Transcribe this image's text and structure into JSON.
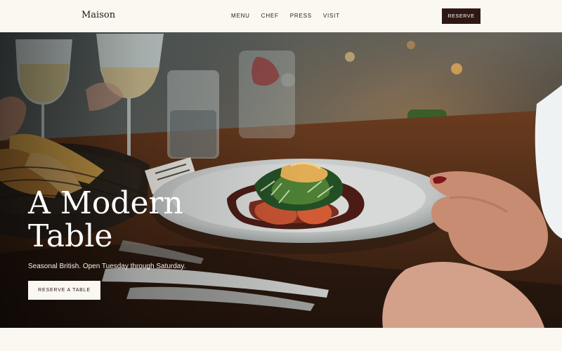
{
  "brand": {
    "name": "Maison"
  },
  "nav": {
    "items": [
      {
        "label": "MENU"
      },
      {
        "label": "CHEF"
      },
      {
        "label": "PRESS"
      },
      {
        "label": "VISIT"
      }
    ],
    "reserve_label": "RESERVE"
  },
  "hero": {
    "title": "A Modern Table",
    "subtitle": "Seasonal British. Open Tuesday through Saturday.",
    "cta_label": "RESERVE A TABLE"
  },
  "colors": {
    "background": "#fbf7f1",
    "primary_button": "#2f1813",
    "text_dark": "#1f1712"
  },
  "icons": [
    "plated-dish-photo",
    "wine-glass-icon",
    "bread-basket-icon"
  ]
}
